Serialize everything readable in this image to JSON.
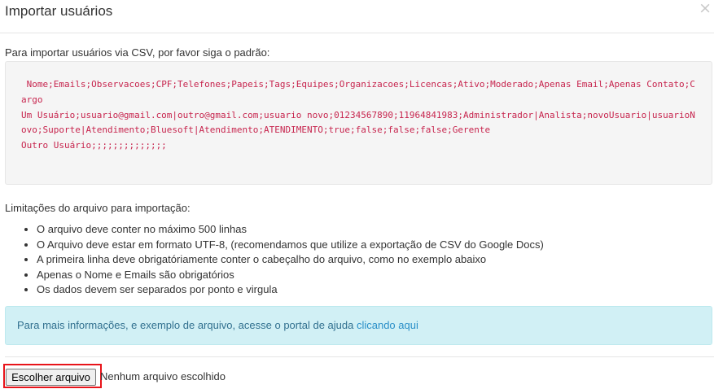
{
  "modal": {
    "title": "Importar usuários",
    "close_symbol": "×"
  },
  "intro": "Para importar usuários via CSV, por favor siga o padrão:",
  "csv_example": {
    "lines": [
      " Nome;Emails;Observacoes;CPF;Telefones;Papeis;Tags;Equipes;Organizacoes;Licencas;Ativo;Moderado;Apenas Email;Apenas Contato;Cargo",
      "Um Usuário;usuario@gmail.com|outro@gmail.com;usuario novo;01234567890;11964841983;Administrador|Analista;novoUsuario|usuarioNovo;Suporte|Atendimento;Bluesoft|Atendimento;ATENDIMENTO;true;false;false;false;Gerente",
      "Outro Usuário;;;;;;;;;;;;;;"
    ]
  },
  "limits": {
    "heading": "Limitações do arquivo para importação:",
    "items": [
      "O arquivo deve conter no máximo 500 linhas",
      "O Arquivo deve estar em formato UTF-8, (recomendamos que utilize a exportação de CSV do Google Docs)",
      "A primeira linha deve obrigatóriamente conter o cabeçalho do arquivo, como no exemplo abaixo",
      "Apenas o Nome e Emails são obrigatórios",
      "Os dados devem ser separados por ponto e virgula"
    ]
  },
  "info_alert": {
    "text": "Para mais informações, e exemplo de arquivo, acesse o portal de ajuda ",
    "link_text": "clicando aqui"
  },
  "file_input": {
    "button_label": "Escolher arquivo",
    "status": "Nenhum arquivo escolhido"
  },
  "colors": {
    "code_text": "#c7254e",
    "code_background": "#f5f5f5",
    "info_background": "#d1f0f5",
    "info_text": "#31708f",
    "link": "#2a8fc8",
    "highlight_border": "#e8141a"
  }
}
